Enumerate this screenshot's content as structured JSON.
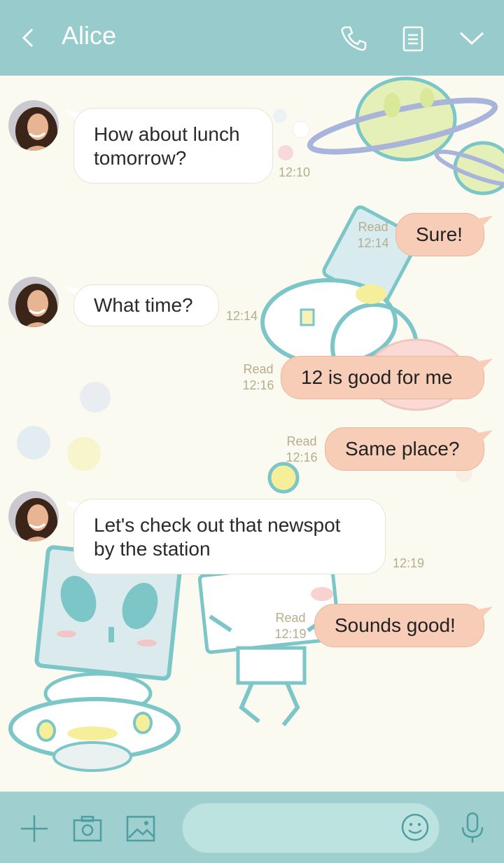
{
  "header": {
    "back_icon": "chevron-left-icon",
    "title": "Alice",
    "actions": [
      "phone-icon",
      "notes-icon",
      "chevron-down-icon"
    ]
  },
  "messages": [
    {
      "side": "in",
      "avatar": "contact-avatar",
      "lines": [
        "How about lunch",
        "tomorrow?"
      ],
      "time": "12:10"
    },
    {
      "side": "out",
      "text": "Sure!",
      "read": "Read",
      "time": "12:14"
    },
    {
      "side": "in",
      "avatar": "contact-avatar",
      "lines": [
        "What time?"
      ],
      "time": "12:14"
    },
    {
      "side": "out",
      "text": "12 is good for me",
      "read": "Read",
      "time": "12:16"
    },
    {
      "side": "out",
      "text": "Same place?",
      "read": "Read",
      "time": "12:16"
    },
    {
      "side": "in",
      "avatar": "contact-avatar",
      "lines": [
        "Let's check out that newspot",
        "by the station"
      ],
      "time": "12:19"
    },
    {
      "side": "out",
      "text": "Sounds good!",
      "read": "Read",
      "time": "12:19"
    }
  ],
  "footer": {
    "icons": [
      "plus-icon",
      "camera-icon",
      "image-icon",
      "emoji-icon",
      "microphone-icon"
    ],
    "input_placeholder": ""
  },
  "colors": {
    "header": "#97cbcc",
    "background": "#fbfaf1",
    "incoming_bubble": "#ffffff",
    "outgoing_bubble": "#f7cdb8",
    "meta_text": "#b7ad8b",
    "footer": "#9fcfcf",
    "icon": "#4d9ea0"
  }
}
